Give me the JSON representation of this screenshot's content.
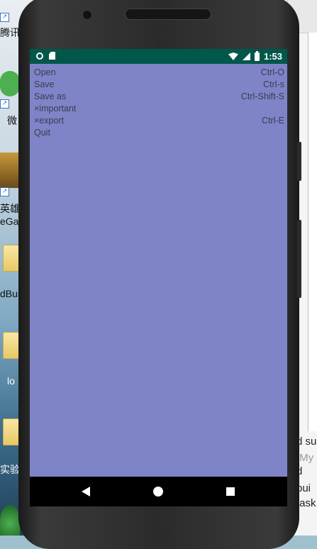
{
  "desktop": {
    "icon_labels": [
      "腾讯",
      "微",
      "英雄",
      "eGa",
      "dBui",
      "lo",
      "实验"
    ]
  },
  "right_panel": {
    "lines": [
      "d su",
      "\\My",
      "d",
      "bui",
      "task"
    ]
  },
  "status_bar": {
    "time": "1:53",
    "icons": [
      "circle-icon",
      "sd-card-icon",
      "wifi-icon",
      "signal-icon",
      "battery-charging-icon"
    ]
  },
  "menu": {
    "items": [
      {
        "label": "Open",
        "shortcut": "Ctrl-O"
      },
      {
        "label": "Save",
        "shortcut": "Ctrl-s"
      },
      {
        "label": "Save as",
        "shortcut": "Ctrl-Shift-S"
      },
      {
        "label": "×important",
        "shortcut": ""
      },
      {
        "label": "×export",
        "shortcut": "Ctrl-E"
      },
      {
        "label": "Quit",
        "shortcut": ""
      }
    ]
  },
  "nav_bar": {
    "buttons": [
      "back-icon",
      "home-icon",
      "recents-icon"
    ]
  },
  "colors": {
    "screen_bg": "#7f84c8",
    "status_bar_bg": "#01574a",
    "menu_text": "#3a3c4f",
    "nav_bar_bg": "#000000"
  }
}
